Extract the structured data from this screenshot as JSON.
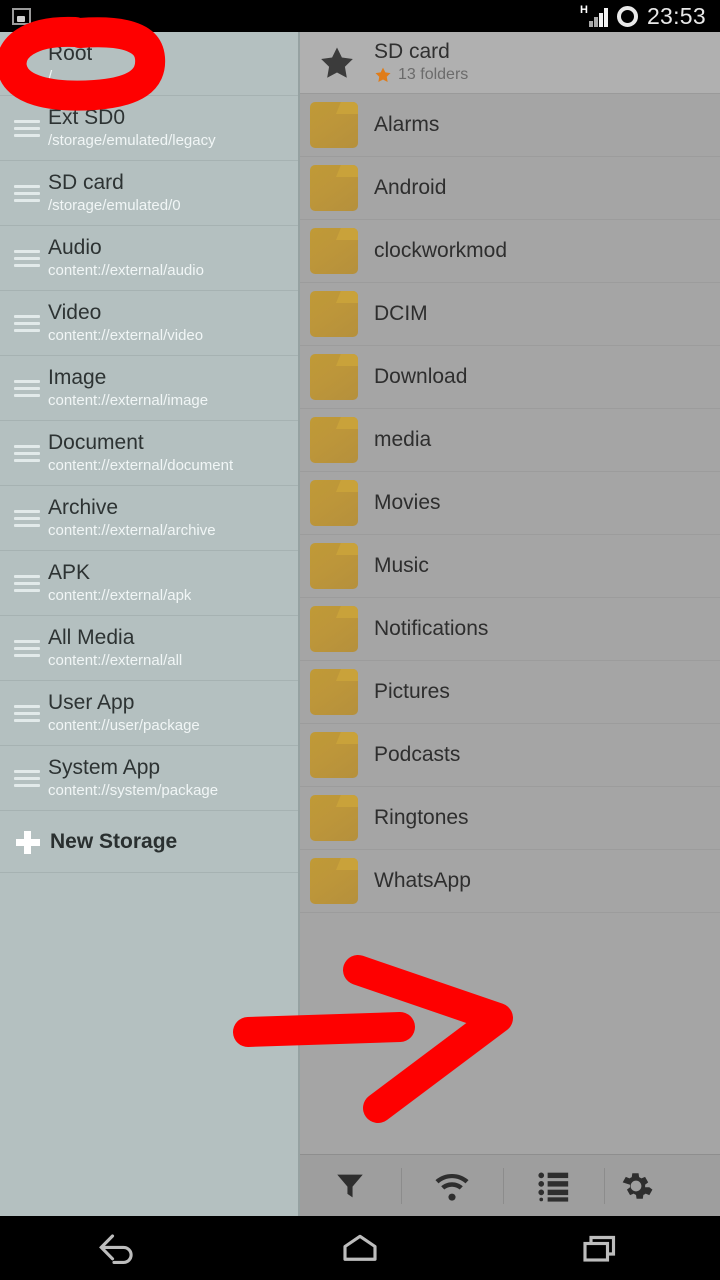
{
  "status_bar": {
    "left_icon": "screenshot-icon",
    "network_type": "H",
    "signal_icon": "signal-bars-icon",
    "ring_icon": "circle-ring-icon",
    "clock": "23:53"
  },
  "sidebar": {
    "items": [
      {
        "title": "Root",
        "subtitle": "/",
        "handle": false
      },
      {
        "title": "Ext SD0",
        "subtitle": "/storage/emulated/legacy",
        "handle": true
      },
      {
        "title": "SD card",
        "subtitle": "/storage/emulated/0",
        "handle": true
      },
      {
        "title": "Audio",
        "subtitle": "content://external/audio",
        "handle": true
      },
      {
        "title": "Video",
        "subtitle": "content://external/video",
        "handle": true
      },
      {
        "title": "Image",
        "subtitle": "content://external/image",
        "handle": true
      },
      {
        "title": "Document",
        "subtitle": "content://external/document",
        "handle": true
      },
      {
        "title": "Archive",
        "subtitle": "content://external/archive",
        "handle": true
      },
      {
        "title": "APK",
        "subtitle": "content://external/apk",
        "handle": true
      },
      {
        "title": "All Media",
        "subtitle": "content://external/all",
        "handle": true
      },
      {
        "title": "User App",
        "subtitle": "content://user/package",
        "handle": true
      },
      {
        "title": "System App",
        "subtitle": "content://system/package",
        "handle": true
      }
    ],
    "new_storage": {
      "label": "New Storage",
      "icon": "plus-icon"
    }
  },
  "main": {
    "header": {
      "star_icon": "star-icon",
      "title": "SD card",
      "favorite_star_icon": "star-orange-icon",
      "subtitle": "13 folders",
      "accent_color": "#e07c18"
    },
    "folders": [
      {
        "name": "Alarms"
      },
      {
        "name": "Android"
      },
      {
        "name": "clockworkmod"
      },
      {
        "name": "DCIM"
      },
      {
        "name": "Download"
      },
      {
        "name": "media"
      },
      {
        "name": "Movies"
      },
      {
        "name": "Music"
      },
      {
        "name": "Notifications"
      },
      {
        "name": "Pictures"
      },
      {
        "name": "Podcasts"
      },
      {
        "name": "Ringtones"
      },
      {
        "name": "WhatsApp"
      }
    ],
    "folder_icon": "folder-icon",
    "folder_color": "#bd963a"
  },
  "toolbar": {
    "buttons": [
      {
        "icon": "filter-icon",
        "label": "Filter"
      },
      {
        "icon": "wifi-icon",
        "label": "Network"
      },
      {
        "icon": "list-view-icon",
        "label": "View"
      },
      {
        "icon": "gear-icon",
        "label": "Settings"
      }
    ]
  },
  "nav_bar": {
    "buttons": [
      {
        "icon": "back-icon",
        "label": "Back"
      },
      {
        "icon": "home-icon",
        "label": "Home"
      },
      {
        "icon": "recents-icon",
        "label": "Recents"
      }
    ]
  },
  "annotations": {
    "color": "#fe0000",
    "items": [
      {
        "type": "circle",
        "target": "sidebar-item-root"
      },
      {
        "type": "arrow",
        "target": "empty-list-area",
        "direction": "right"
      }
    ]
  }
}
